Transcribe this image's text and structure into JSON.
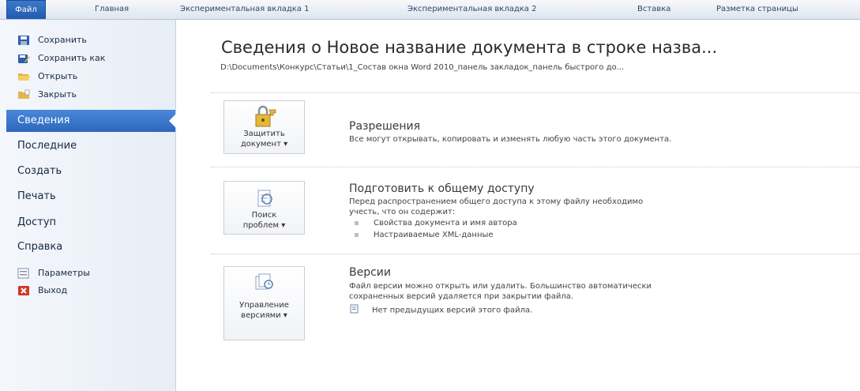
{
  "ribbon": {
    "tabs": [
      "Файл",
      "Главная",
      "Экспериментальная вкладка 1",
      "Экспериментальная вкладка 2",
      "Вставка",
      "Разметка страницы"
    ]
  },
  "sidebar": {
    "commands": [
      {
        "label": "Сохранить",
        "icon": "save-icon"
      },
      {
        "label": "Сохранить как",
        "icon": "save-as-icon"
      },
      {
        "label": "Открыть",
        "icon": "open-folder-icon"
      },
      {
        "label": "Закрыть",
        "icon": "close-folder-icon"
      }
    ],
    "sections": [
      "Сведения",
      "Последние",
      "Создать",
      "Печать",
      "Доступ",
      "Справка"
    ],
    "bottom_commands": [
      {
        "label": "Параметры",
        "icon": "options-icon"
      },
      {
        "label": "Выход",
        "icon": "exit-icon"
      }
    ]
  },
  "main": {
    "title": "Сведения о Новое название документа в строке назва...",
    "path": "D:\\Documents\\Конкурс\\Статьи\\1_Состав окна Word 2010_панель закладок_панель быстрого до...",
    "permissions": {
      "button_line1": "Защитить",
      "button_line2": "документ ▾",
      "heading": "Разрешения",
      "description": "Все могут открывать, копировать и изменять любую часть этого документа."
    },
    "prepare": {
      "button_line1": "Поиск",
      "button_line2": "проблем ▾",
      "heading": "Подготовить к общему доступу",
      "description_line1": "Перед распространением общего доступа к этому файлу необходимо",
      "description_line2": "учесть, что он содержит:",
      "bullets": [
        "Свойства документа и имя автора",
        "Настраиваемые XML-данные"
      ]
    },
    "versions": {
      "button_line1": "Управление",
      "button_line2": "версиями ▾",
      "heading": "Версии",
      "description_line1": "Файл версии можно открыть или удалить. Большинство автоматически",
      "description_line2": "сохраненных версий удаляется при закрытии файла.",
      "note": "Нет предыдущих версий этого файла."
    }
  },
  "colors": {
    "accent": "#2c67bd",
    "file_tab": "#1f5bb0",
    "sidebar": "#eef2f8"
  }
}
